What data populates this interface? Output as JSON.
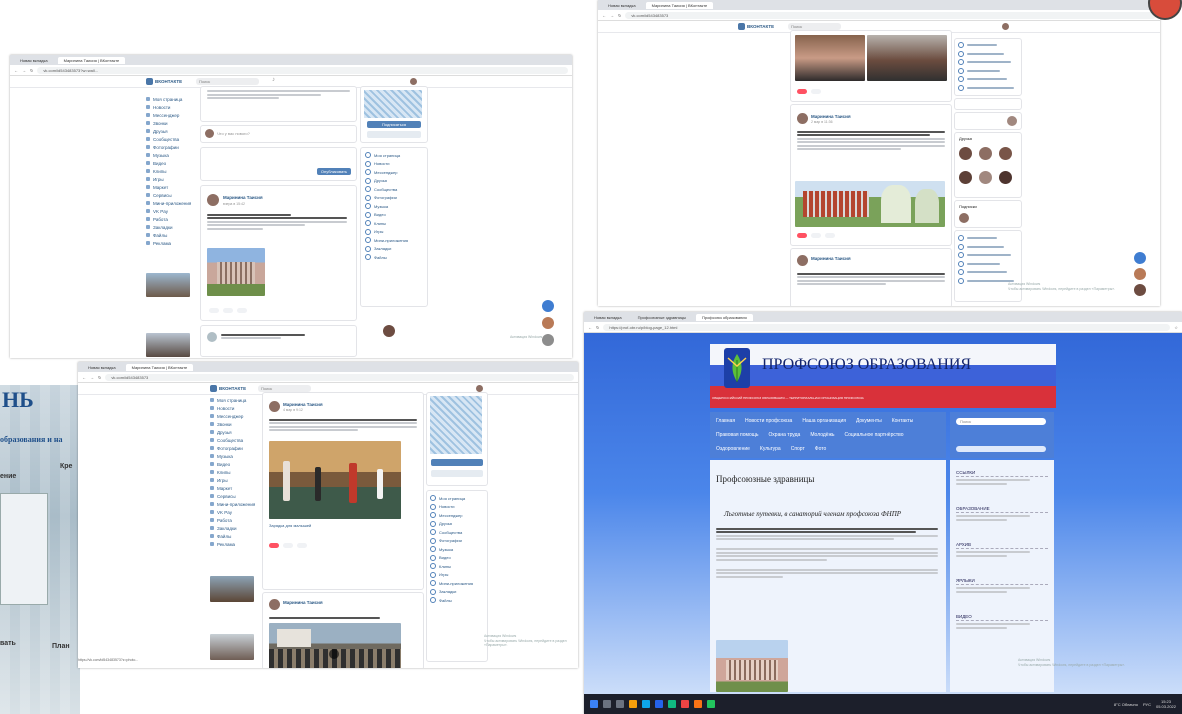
{
  "shot1": {
    "tabs": [
      "Новая вкладка",
      "Маринина Таисия | ВКонтакте"
    ],
    "url": "vk.com/id543483573?w=wall...",
    "brand": "ВКОНТАКТЕ",
    "search_placeholder": "Поиск",
    "menu": [
      "Моя страница",
      "Новости",
      "Мессенджер",
      "Звонки",
      "Друзья",
      "Сообщества",
      "Фотографии",
      "Музыка",
      "Видео",
      "Клипы",
      "Игры",
      "Маркет",
      "Сервисы",
      "Мини-приложения",
      "VK Pay",
      "Работа",
      "Закладки",
      "Файлы",
      "Реклама"
    ],
    "post_author": "Маринина Таисия",
    "post_date": "вчера в 15:42",
    "composer_placeholder": "Что у вас нового?",
    "publish_btn": "Опубликовать",
    "right_menu": [
      "Моя страница",
      "Новости",
      "Мессенджер",
      "Друзья",
      "Сообщества",
      "Фотографии",
      "Музыка",
      "Видео",
      "Клипы",
      "Игры",
      "Мини-приложения",
      "Закладки",
      "Файлы"
    ],
    "group_btn": "Подписаться"
  },
  "shot2": {
    "tabs": [
      "Новая вкладка",
      "Маринина Таисия | ВКонтакте"
    ],
    "url": "vk.com/id543483573",
    "brand": "ВКОНТАКТЕ",
    "search_placeholder": "Поиск",
    "post_author": "Маринина Таисия",
    "post_date": "2 мар в 11:36",
    "friends_label": "Друзья",
    "groups_label": "Подписки",
    "watermark_line1": "Активация Windows",
    "watermark_line2": "Чтобы активировать Windows, перейдите в раздел «Параметры»."
  },
  "shot3": {
    "tabs": [
      "Новая вкладка",
      "Маринина Таисия | ВКонтакте"
    ],
    "url": "vk.com/id543483573",
    "brand": "ВКОНТАКТЕ",
    "search_placeholder": "Поиск",
    "post_author": "Маринина Таисия",
    "post_date": "4 мар в 9:12",
    "video_caption": "Зарядка для малышей",
    "status_url": "https://vk.com/id543483573?z=photo...",
    "watermark_line1": "Активация Windows",
    "watermark_line2": "Чтобы активировать Windows, перейдите в раздел «Параметры»."
  },
  "shot4": {
    "tabs": [
      "Новая вкладка",
      "Профсоюзные здравницы",
      "Профсоюз образования"
    ],
    "url": "https://prof-obr.ru/p/blog-page_12.html",
    "site_title": "ПРОФСОЮЗ ОБРАЗОВАНИЯ",
    "site_subtitle": "ОБЩЕРОССИЙСКИЙ ПРОФСОЮЗ ОБРАЗОВАНИЯ — ТЕРРИТОРИАЛЬНАЯ ОРГАНИЗАЦИЯ ПРОФСОЮЗА",
    "nav": [
      "Главная",
      "Новости профсоюза",
      "Наша организация",
      "Документы",
      "Контакты",
      "Правовая помощь",
      "Охрана труда",
      "Молодёжь",
      "Социальное партнёрство",
      "Оздоровление",
      "Культура",
      "Спорт",
      "Фото"
    ],
    "page_heading": "Профсоюзные здравницы",
    "article_heading": "Льготные путевки, в санаторий членам профсоюза ФНПР",
    "sidebar_heads": [
      "ССЫЛКИ",
      "ОБРАЗОВАНИЕ",
      "АРХИВ",
      "ЯРЛЫКИ",
      "ВИДЕО"
    ],
    "search_placeholder": "Поиск",
    "watermark_line1": "Активация Windows",
    "watermark_line2": "Чтобы активировать Windows, перейдите в раздел «Параметры».",
    "clock_time": "15:23",
    "clock_date": "05.03.2022",
    "weather": "8°C Облачно",
    "lang": "РУС"
  },
  "board": {
    "text_lines": [
      "НЬ",
      "образования и на",
      "Кре",
      "ение",
      "вать",
      "План"
    ]
  },
  "colors": {
    "vk_blue": "#4a76a8",
    "vk_link": "#2a5885",
    "site_header_top": "#1e4fbf",
    "taskbar": "#1c1f2b"
  }
}
